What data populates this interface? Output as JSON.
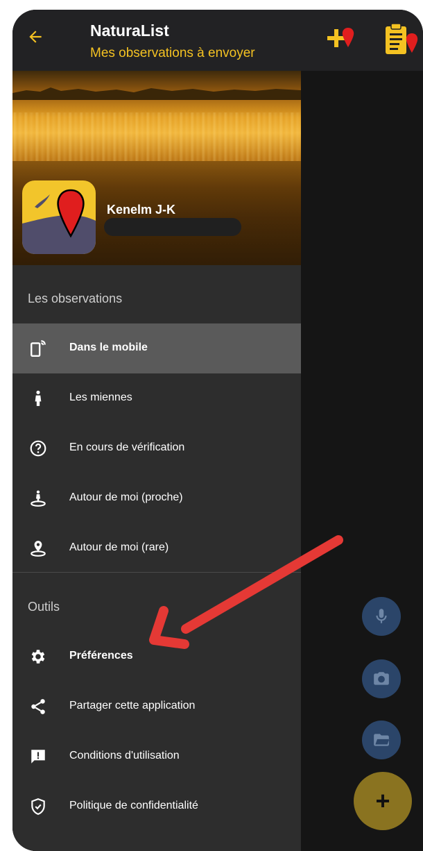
{
  "app": {
    "title": "NaturaList",
    "subtitle": "Mes observations à envoyer"
  },
  "profile": {
    "name": "Kenelm J-K"
  },
  "drawer": {
    "sections": [
      {
        "label": "Les observations",
        "items": [
          {
            "label": "Dans le mobile",
            "icon": "phone-sync-icon",
            "active": true
          },
          {
            "label": "Les miennes",
            "icon": "person-icon"
          },
          {
            "label": "En cours de vérification",
            "icon": "question-circle-icon"
          },
          {
            "label": "Autour de moi (proche)",
            "icon": "person-pin-circle-icon"
          },
          {
            "label": "Autour de moi (rare)",
            "icon": "location-pin-circle-icon"
          }
        ]
      },
      {
        "label": "Outils",
        "items": [
          {
            "label": "Préférences",
            "icon": "gear-icon"
          },
          {
            "label": "Partager cette application",
            "icon": "share-icon"
          },
          {
            "label": "Conditions d'utilisation",
            "icon": "feedback-icon"
          },
          {
            "label": "Politique de confidentialité",
            "icon": "shield-check-icon"
          }
        ]
      }
    ]
  },
  "fabs": {
    "mic_icon": "microphone-icon",
    "camera_icon": "camera-icon",
    "folder_icon": "folder-open-icon",
    "add_label": "+"
  },
  "colors": {
    "accent_yellow": "#f4c222",
    "pin_red": "#e01e1e",
    "annotation_arrow": "#e53935",
    "active_item_bg": "#5a5a5a"
  }
}
